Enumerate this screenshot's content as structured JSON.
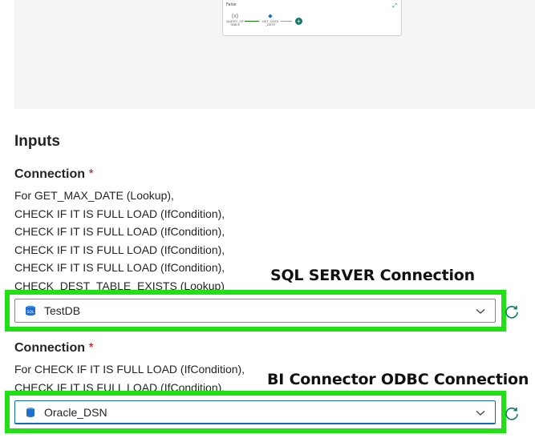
{
  "preview": {
    "pipeline_title": "False",
    "nodes": [
      {
        "glyph": "(x)",
        "label": "QUERY_OF\nTABLE"
      },
      {
        "glyph": "◆",
        "label": "GET_DATA\n_DATE"
      }
    ],
    "expand_icon": "expand-icon",
    "add_icon": "add-icon"
  },
  "inputs": {
    "title": "Inputs",
    "connections": [
      {
        "label": "Connection",
        "required_mark": "*",
        "used_by": [
          "For GET_MAX_DATE (Lookup),",
          "CHECK IF IT IS FULL LOAD (IfCondition),",
          "CHECK IF IT IS FULL LOAD (IfCondition),",
          "CHECK IF IT IS FULL LOAD (IfCondition),",
          "CHECK IF IT IS FULL LOAD (IfCondition),",
          "CHECK_DEST_TABLE_EXISTS (Lookup)"
        ],
        "callout": "SQL SERVER Connection",
        "selected": "TestDB",
        "icon": "sql-database-icon",
        "icon_text": "SQL",
        "refresh_icon": "refresh-icon"
      },
      {
        "label": "Connection",
        "required_mark": "*",
        "used_by": [
          "For CHECK IF IT IS FULL LOAD (IfCondition),",
          "CHECK IF IT IS FULL LOAD (IfCondition),"
        ],
        "callout": "BI Connector ODBC Connection",
        "selected": "Oracle_DSN",
        "icon": "database-icon",
        "refresh_icon": "refresh-icon"
      }
    ]
  },
  "colors": {
    "highlight": "#22e016",
    "accent": "#0f6cbd",
    "required": "#c50f1f",
    "preview_bg": "#f5f5f5"
  }
}
